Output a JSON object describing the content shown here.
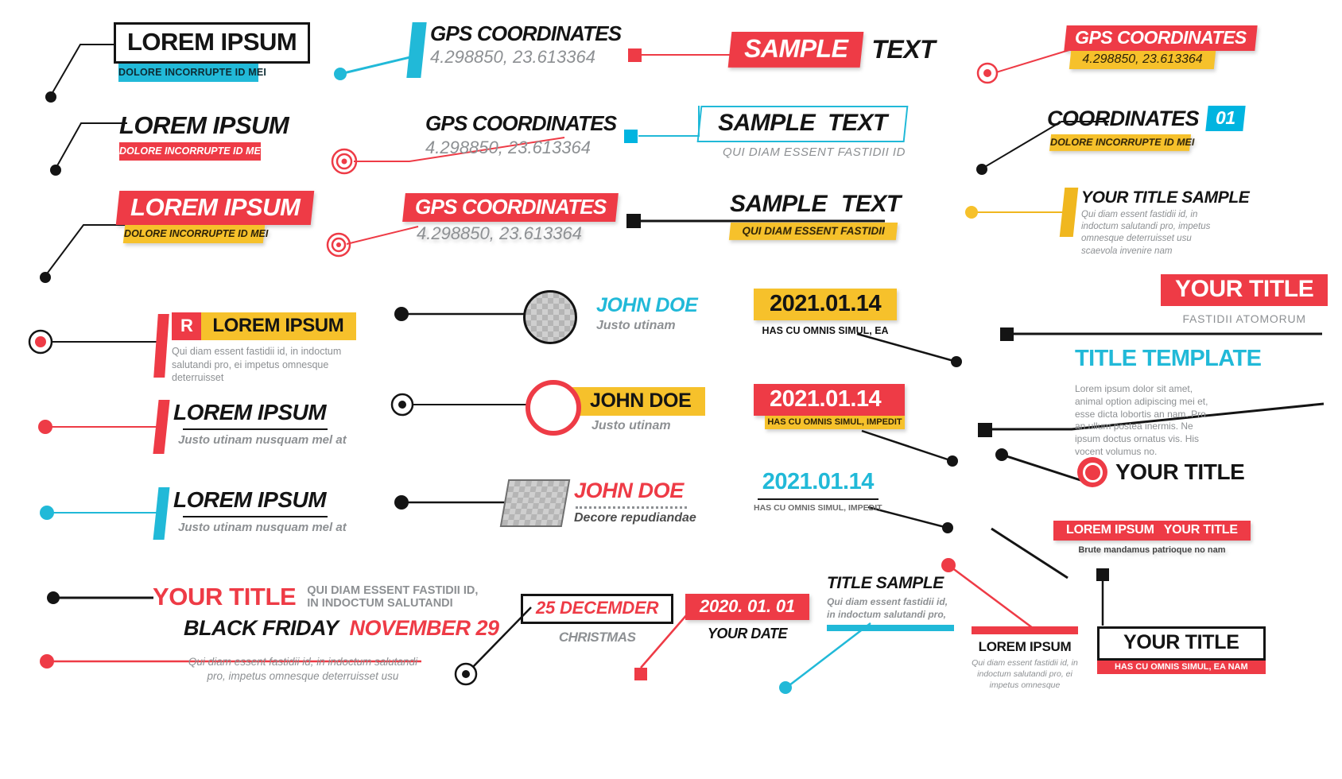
{
  "palette": {
    "red": "#ee3b46",
    "cyan": "#21b9d8",
    "yellow": "#f6c12b",
    "yellow_deep": "#f0b71f",
    "black": "#141414",
    "gray": "#8d9093",
    "white": "#ffffff"
  },
  "items": {
    "c1r1": {
      "title": "LOREM IPSUM",
      "sub": "DOLORE INCORRUPTE ID MEI"
    },
    "c1r2": {
      "title": "LOREM IPSUM",
      "sub": "DOLORE INCORRUPTE ID MEI"
    },
    "c1r3": {
      "title": "LOREM IPSUM",
      "sub": "DOLORE INCORRUPTE ID MEI"
    },
    "c2r1": {
      "title": "GPS COORDINATES",
      "sub": "4.298850, 23.613364"
    },
    "c2r2": {
      "title": "GPS COORDINATES",
      "sub": "4.298850, 23.613364"
    },
    "c2r3": {
      "title": "GPS COORDINATES",
      "sub": "4.298850, 23.613364"
    },
    "c3r1": {
      "title_a": "SAMPLE",
      "title_b": "TEXT"
    },
    "c3r2": {
      "title_a": "SAMPLE",
      "title_b": "TEXT",
      "sub": "QUI DIAM ESSENT FASTIDII ID"
    },
    "c3r3": {
      "title_a": "SAMPLE",
      "title_b": "TEXT",
      "sub": "QUI DIAM ESSENT FASTIDII"
    },
    "c4r1": {
      "title": "GPS COORDINATES",
      "sub": "4.298850, 23.613364"
    },
    "c4r2": {
      "title": "COORDINATES",
      "badge": "01",
      "sub": "DOLORE INCORRUPTE ID MEI"
    },
    "c4r3": {
      "title": "YOUR TITLE SAMPLE",
      "body": "Qui diam essent fastidii id, in indoctum salutandi pro, impetus omnesque deterruisset usu scaevola invenire nam"
    },
    "m1r1": {
      "badge": "R",
      "title": "LOREM IPSUM",
      "body": "Qui diam essent fastidii id, in indoctum salutandi pro, ei impetus omnesque deterruisset"
    },
    "m1r2": {
      "title": "LOREM IPSUM",
      "sub": "Justo utinam nusquam mel at"
    },
    "m1r3": {
      "title": "LOREM IPSUM",
      "sub": "Justo utinam nusquam mel at"
    },
    "m2r1": {
      "title": "JOHN DOE",
      "sub": "Justo utinam"
    },
    "m2r2": {
      "title": "JOHN DOE",
      "sub": "Justo utinam"
    },
    "m2r3": {
      "title": "JOHN DOE",
      "sub": "Decore repudiandae"
    },
    "m3r1": {
      "title": "2021.01.14",
      "sub": "HAS CU OMNIS SIMUL, EA"
    },
    "m3r2": {
      "title": "2021.01.14",
      "sub": "HAS CU OMNIS SIMUL, IMPEDIT"
    },
    "m3r3": {
      "title": "2021.01.14",
      "sub": "HAS CU OMNIS SIMUL, IMPEDIT"
    },
    "m4r1": {
      "title": "YOUR TITLE",
      "sub": "FASTIDII  ATOMORUM"
    },
    "m4r2": {
      "title": "TITLE TEMPLATE",
      "body": "Lorem ipsum dolor sit amet, animal option adipiscing mei et, esse dicta lobortis an nam. Pro an ullum postea inermis. Ne ipsum doctus ornatus vis. His vocent volumus no."
    },
    "m4r3": {
      "title": "YOUR TITLE"
    },
    "m4r4": {
      "title_a": "LOREM IPSUM",
      "title_b": "YOUR TITLE",
      "sub": "Brute mandamus patrioque no nam"
    },
    "b1": {
      "title": "YOUR TITLE",
      "sub_line1": "QUI DIAM ESSENT FASTIDII ID,",
      "sub_line2": "IN INDOCTUM SALUTANDI"
    },
    "b2": {
      "title_a": "BLACK FRIDAY",
      "title_b": "NOVEMBER 29",
      "body": "Qui diam essent fastidii id, in indoctum salutandi pro, impetus omnesque deterruisset usu"
    },
    "b3": {
      "title": "25 DECEMDER",
      "sub": "CHRISTMAS"
    },
    "b4": {
      "title": "2020. 01. 01",
      "sub": "YOUR DATE"
    },
    "b5": {
      "title": "TITLE SAMPLE",
      "body_line1": "Qui diam essent fastidii id,",
      "body_line2": "in indoctum salutandi pro,"
    },
    "b6": {
      "title": "LOREM IPSUM",
      "body": "Qui diam essent fastidii id, in indoctum salutandi pro, ei impetus omnesque"
    },
    "b7": {
      "title": "YOUR TITLE",
      "sub": "HAS CU OMNIS SIMUL, EA NAM"
    }
  }
}
